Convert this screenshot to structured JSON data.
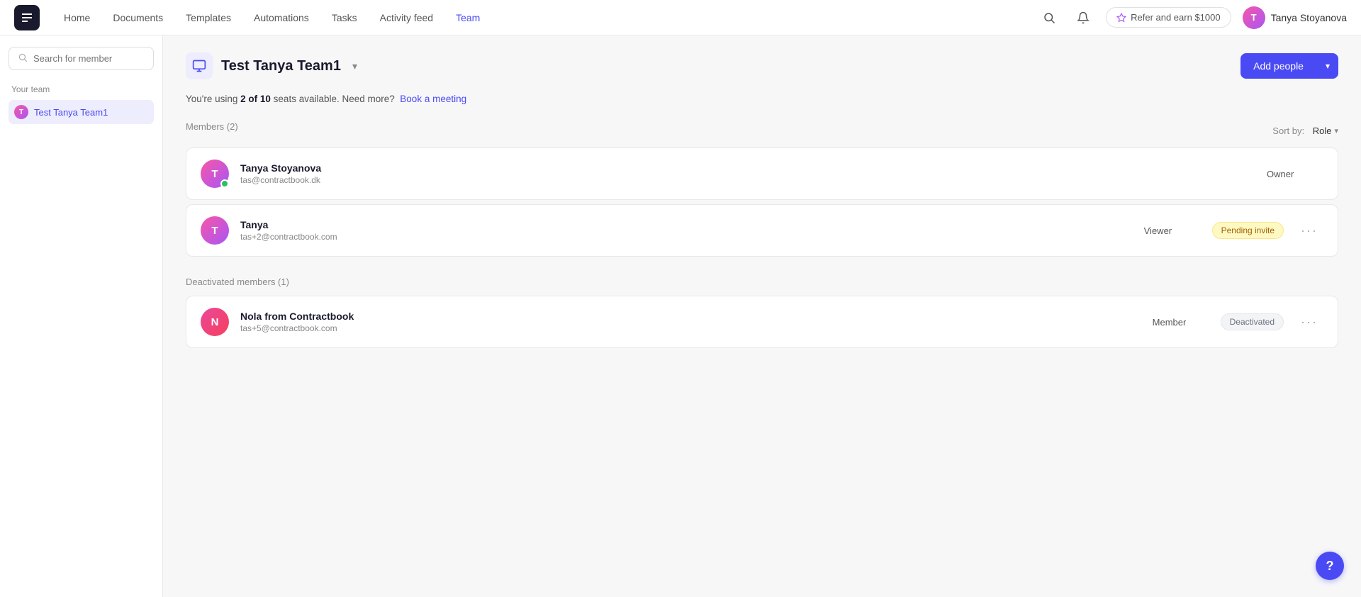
{
  "nav": {
    "links": [
      {
        "id": "home",
        "label": "Home",
        "active": false
      },
      {
        "id": "documents",
        "label": "Documents",
        "active": false
      },
      {
        "id": "templates",
        "label": "Templates",
        "active": false
      },
      {
        "id": "automations",
        "label": "Automations",
        "active": false
      },
      {
        "id": "tasks",
        "label": "Tasks",
        "active": false
      },
      {
        "id": "activity-feed",
        "label": "Activity feed",
        "active": false
      },
      {
        "id": "team",
        "label": "Team",
        "active": true
      }
    ],
    "refer_label": "Refer and earn $1000",
    "user_name": "Tanya Stoyanova",
    "user_initials": "T"
  },
  "sidebar": {
    "search_placeholder": "Search for member",
    "your_team_label": "Your team",
    "team_item": "Test Tanya Team1"
  },
  "main": {
    "team_title": "Test Tanya Team1",
    "add_people_label": "Add people",
    "info_text_before": "You're using ",
    "info_seats_used": "2 of 10",
    "info_text_after": " seats available. Need more?",
    "info_link": "Book a meeting",
    "members_section_label": "Members (2)",
    "sort_label": "Sort by:",
    "sort_value": "Role",
    "members": [
      {
        "name": "Tanya Stoyanova",
        "email": "tas@contractbook.dk",
        "role": "Owner",
        "initials": "T",
        "avatar_color_start": "#f857a6",
        "avatar_color_end": "#a855f7",
        "online": true,
        "badge": null,
        "has_actions": false
      },
      {
        "name": "Tanya",
        "email": "tas+2@contractbook.com",
        "role": "Viewer",
        "initials": "T",
        "avatar_color_start": "#f857a6",
        "avatar_color_end": "#a855f7",
        "online": false,
        "badge": "Pending invite",
        "badge_type": "pending",
        "has_actions": true
      }
    ],
    "deactivated_section_label": "Deactivated members (1)",
    "deactivated_members": [
      {
        "name": "Nola from Contractbook",
        "email": "tas+5@contractbook.com",
        "role": "Member",
        "initials": "N",
        "avatar_color_start": "#ec4899",
        "avatar_color_end": "#f43f5e",
        "online": false,
        "badge": "Deactivated",
        "badge_type": "deactivated",
        "has_actions": true
      }
    ],
    "help_label": "?"
  }
}
